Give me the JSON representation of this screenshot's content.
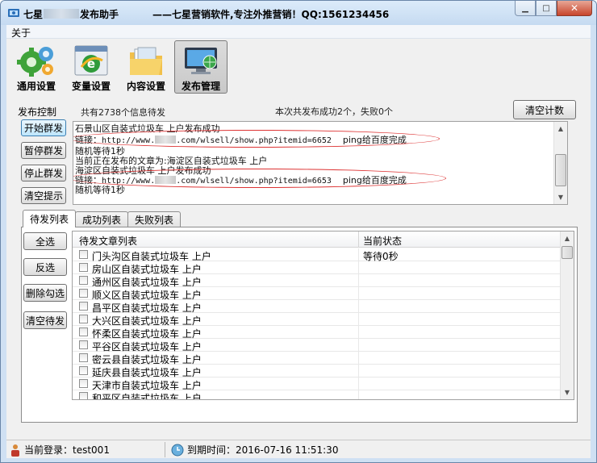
{
  "window": {
    "title_prefix": "七星",
    "title_suffix": "发布助手",
    "slogan": "——七星营销软件,专注外推营销！QQ:1561234456",
    "minimize_glyph": "▁",
    "maximize_glyph": "□",
    "close_glyph": "✕"
  },
  "menu": {
    "about": "关于"
  },
  "toolbar": [
    {
      "label": "通用设置",
      "icon": "gears-icon",
      "active": false
    },
    {
      "label": "变量设置",
      "icon": "ie-globe-icon",
      "active": false
    },
    {
      "label": "内容设置",
      "icon": "folder-icon",
      "active": false
    },
    {
      "label": "发布管理",
      "icon": "monitor-globe-icon",
      "active": true
    }
  ],
  "publish": {
    "label": "发布控制",
    "count_text": "共有2738个信息待发",
    "summary": "本次共发布成功2个，失败0个",
    "clear_count": "清空计数",
    "start": "开始群发",
    "pause": "暂停群发",
    "stop": "停止群发",
    "clear_tips": "清空提示"
  },
  "log": [
    {
      "type": "text",
      "text": "石景山区自装式垃圾车 上户发布成功"
    },
    {
      "type": "link",
      "prefix": "链接：",
      "url_start": "http://www.",
      "url_end": ".com/wlsell/show.php?itemid=6652",
      "ping": "ping给百度完成"
    },
    {
      "type": "text",
      "text": "随机等待1秒"
    },
    {
      "type": "text",
      "text": "当前正在发布的文章为:海淀区自装式垃圾车 上户"
    },
    {
      "type": "text",
      "text": "海淀区自装式垃圾车 上户发布成功"
    },
    {
      "type": "link",
      "prefix": "链接：",
      "url_start": "http://www.",
      "url_end": ".com/wlsell/show.php?itemid=6653",
      "ping": "ping给百度完成"
    },
    {
      "type": "text",
      "text": "随机等待1秒"
    }
  ],
  "tabs": [
    "待发列表",
    "成功列表",
    "失败列表"
  ],
  "list_buttons": {
    "select_all": "全选",
    "invert": "反选",
    "delete_checked": "删除勾选",
    "clear_pending": "清空待发"
  },
  "grid": {
    "col_title": "待发文章列表",
    "col_status": "当前状态",
    "rows": [
      {
        "title": "门头沟区自装式垃圾车 上户",
        "status": "等待0秒"
      },
      {
        "title": "房山区自装式垃圾车 上户",
        "status": ""
      },
      {
        "title": "通州区自装式垃圾车 上户",
        "status": ""
      },
      {
        "title": "顺义区自装式垃圾车 上户",
        "status": ""
      },
      {
        "title": "昌平区自装式垃圾车 上户",
        "status": ""
      },
      {
        "title": "大兴区自装式垃圾车 上户",
        "status": ""
      },
      {
        "title": "怀柔区自装式垃圾车 上户",
        "status": ""
      },
      {
        "title": "平谷区自装式垃圾车 上户",
        "status": ""
      },
      {
        "title": "密云县自装式垃圾车 上户",
        "status": ""
      },
      {
        "title": "延庆县自装式垃圾车 上户",
        "status": ""
      },
      {
        "title": "天津市自装式垃圾车 上户",
        "status": ""
      },
      {
        "title": "和平区自装式垃圾车 上户",
        "status": ""
      }
    ]
  },
  "status": {
    "login": "当前登录：test001",
    "expire": "到期时间：2016-07-16 11:51:30"
  }
}
